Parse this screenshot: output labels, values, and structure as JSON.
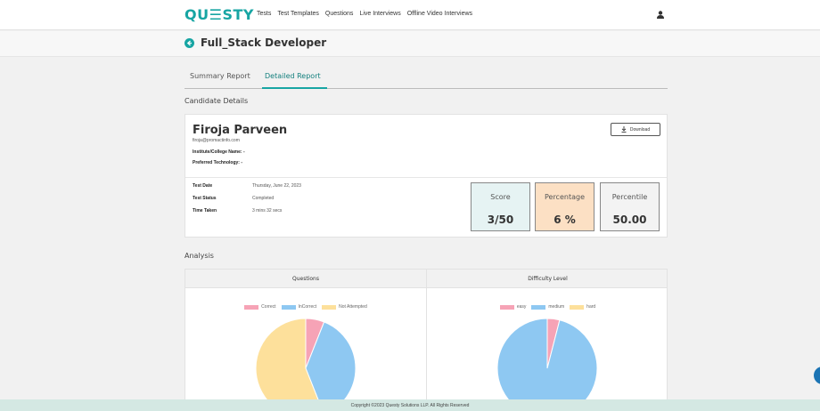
{
  "brand": {
    "logo": "QU☰STY",
    "accent": "#17a5a3"
  },
  "nav": [
    "Tests",
    "Test Templates",
    "Questions",
    "Live Interviews",
    "Offline Video Interviews"
  ],
  "page": {
    "title": "Full_Stack Developer"
  },
  "tabs": [
    "Summary Report",
    "Detailed Report"
  ],
  "sections": {
    "candidate": "Candidate Details",
    "analysis": "Analysis"
  },
  "candidate": {
    "name": "Firoja Parveen",
    "email": "firoja@promactinfo.com",
    "institute": "Institute/College Name: -",
    "technology": "Preferred Technology: -",
    "download_label": "Download",
    "test_date_key": "Test Date",
    "test_date": "Thursday, June 22, 2023",
    "status_key": "Test Status",
    "status": "Completed",
    "time_key": "Time Taken",
    "time": "3 mins 32 secs"
  },
  "stats": {
    "score_label": "Score",
    "score": "3/50",
    "score_color": "#e6f3f3",
    "percentage_label": "Percentage",
    "percentage": "6 %",
    "percentage_color": "#fce0c4",
    "percentile_label": "Percentile",
    "percentile": "50.00"
  },
  "analysis": {
    "questions_title": "Questions",
    "difficulty_title": "Difficulty Level"
  },
  "chart_data": [
    {
      "type": "pie",
      "title": "Questions",
      "categories": [
        "Correct",
        "InCorrect",
        "Not Attempted"
      ],
      "values": [
        3,
        19,
        28
      ],
      "colors": [
        "#f6a3b6",
        "#8ec8f2",
        "#fde09b"
      ],
      "legend": "top"
    },
    {
      "type": "pie",
      "title": "Difficulty Level",
      "categories": [
        "easy",
        "medium",
        "hard"
      ],
      "values": [
        2,
        48,
        0
      ],
      "colors": [
        "#f6a3b6",
        "#8ec8f2",
        "#fde09b"
      ],
      "legend": "top"
    }
  ],
  "footer": "Copyright ©2023 Questy Solutions LLP. All Rights Reserved"
}
